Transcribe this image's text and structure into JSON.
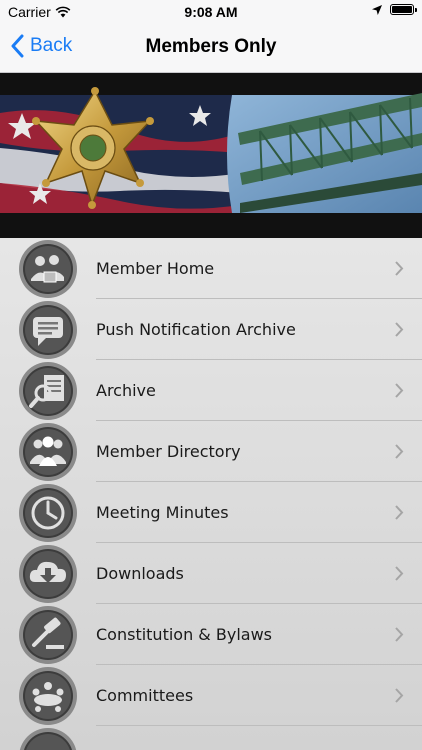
{
  "status_bar": {
    "carrier": "Carrier",
    "time": "9:08 AM"
  },
  "nav": {
    "back_label": "Back",
    "title": "Members Only"
  },
  "menu": {
    "items": [
      {
        "label": "Member Home",
        "icon": "member-home-icon"
      },
      {
        "label": "Push Notification Archive",
        "icon": "chat-bubble-icon"
      },
      {
        "label": "Archive",
        "icon": "magnifier-document-icon"
      },
      {
        "label": "Member Directory",
        "icon": "people-group-icon"
      },
      {
        "label": "Meeting Minutes",
        "icon": "clock-icon"
      },
      {
        "label": "Downloads",
        "icon": "cloud-download-icon"
      },
      {
        "label": "Constitution & Bylaws",
        "icon": "gavel-icon"
      },
      {
        "label": "Committees",
        "icon": "meeting-table-icon"
      }
    ]
  },
  "colors": {
    "accent": "#1a7cf5",
    "list_background": "#dcdcdc"
  }
}
